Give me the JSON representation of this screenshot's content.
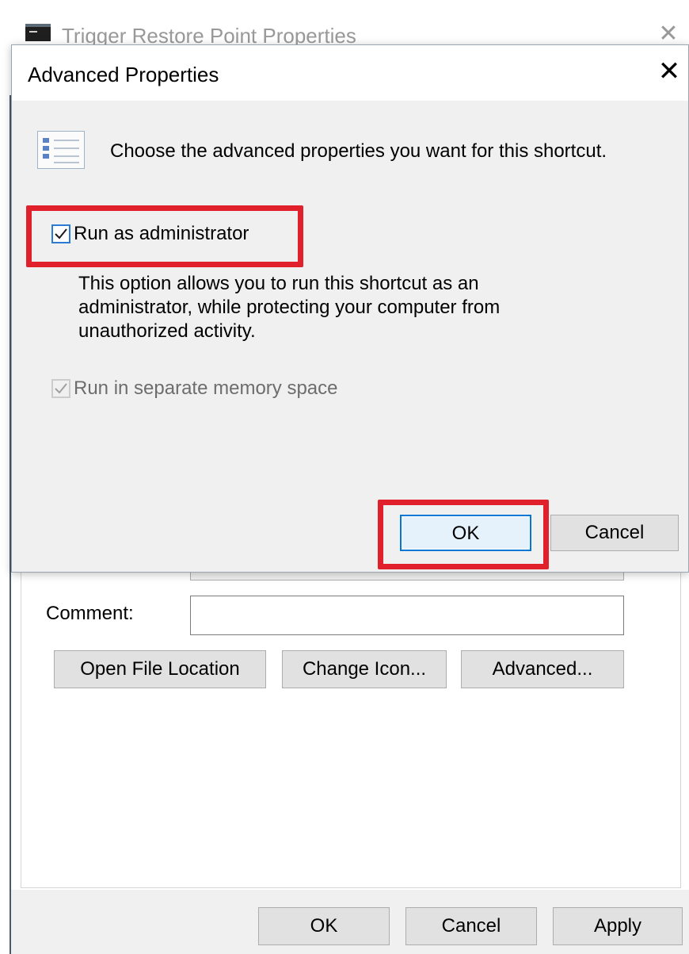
{
  "parent_window": {
    "title": "Trigger Restore Point Properties",
    "close_glyph": "✕",
    "comment_label": "Comment:",
    "comment_value": "",
    "buttons": {
      "open_file_location": "Open File Location",
      "change_icon": "Change Icon...",
      "advanced": "Advanced..."
    },
    "footer_buttons": {
      "ok": "OK",
      "cancel": "Cancel",
      "apply": "Apply"
    }
  },
  "dialog": {
    "title": "Advanced Properties",
    "close_glyph": "✕",
    "intro": "Choose the advanced properties you want for this shortcut.",
    "run_as_admin": {
      "label": "Run as administrator",
      "checked": true,
      "enabled": true
    },
    "description": "This option allows you to run this shortcut as an administrator, while protecting your computer from unauthorized activity.",
    "separate_memory": {
      "label": "Run in separate memory space",
      "checked": true,
      "enabled": false
    },
    "buttons": {
      "ok": "OK",
      "cancel": "Cancel"
    }
  },
  "colors": {
    "highlight": "#e0202a",
    "accent": "#0078d7",
    "dialog_bg": "#f0f0f0"
  },
  "icons": {
    "dialog_icon": "properties-list-icon",
    "window_icon": "console-window-icon"
  }
}
